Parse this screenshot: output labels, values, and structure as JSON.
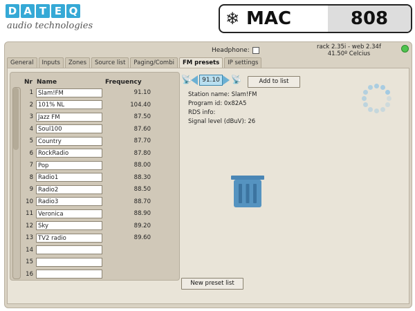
{
  "header": {
    "brand_letters": [
      "D",
      "A",
      "T",
      "E",
      "Q"
    ],
    "brand_subtitle": "audio technologies",
    "product_name": "MAC",
    "product_number": "808"
  },
  "topbar": {
    "headphone_label": "Headphone:",
    "headphone_checked": false,
    "rack_version": "rack 2.35i - web 2.34f",
    "temperature": "41.50º Celcius",
    "status_color": "#4fc34f"
  },
  "tabs": [
    {
      "label": "General",
      "active": false
    },
    {
      "label": "Inputs",
      "active": false
    },
    {
      "label": "Zones",
      "active": false
    },
    {
      "label": "Source list",
      "active": false
    },
    {
      "label": "Paging/Combi",
      "active": false
    },
    {
      "label": "FM presets",
      "active": true
    },
    {
      "label": "IP settings",
      "active": false
    }
  ],
  "presets": {
    "columns": {
      "nr": "Nr",
      "name": "Name",
      "frequency": "Frequency"
    },
    "rows": [
      {
        "nr": "1",
        "name": "Slam!FM",
        "freq": "91.10"
      },
      {
        "nr": "2",
        "name": "101% NL",
        "freq": "104.40"
      },
      {
        "nr": "3",
        "name": "Jazz FM",
        "freq": "87.50"
      },
      {
        "nr": "4",
        "name": "Soul100",
        "freq": "87.60"
      },
      {
        "nr": "5",
        "name": "Country",
        "freq": "87.70"
      },
      {
        "nr": "6",
        "name": "RockRadio",
        "freq": "87.80"
      },
      {
        "nr": "7",
        "name": "Pop",
        "freq": "88.00"
      },
      {
        "nr": "8",
        "name": "Radio1",
        "freq": "88.30"
      },
      {
        "nr": "9",
        "name": "Radio2",
        "freq": "88.50"
      },
      {
        "nr": "10",
        "name": "Radio3",
        "freq": "88.70"
      },
      {
        "nr": "11",
        "name": "Veronica",
        "freq": "88.90"
      },
      {
        "nr": "12",
        "name": "Sky",
        "freq": "89.20"
      },
      {
        "nr": "13",
        "name": "TV2 radio",
        "freq": "89.60"
      },
      {
        "nr": "14",
        "name": "",
        "freq": ""
      },
      {
        "nr": "15",
        "name": "",
        "freq": ""
      },
      {
        "nr": "16",
        "name": "",
        "freq": ""
      }
    ]
  },
  "tuner": {
    "frequency": "91.10",
    "add_label": "Add to list",
    "new_preset_label": "New preset list",
    "station_name": "Station name: Slam!FM",
    "program_id": "Program id: 0x82A5",
    "rds_info": "RDS info:",
    "signal_level": "Signal level (dBuV): 26"
  },
  "icons": {
    "trash": "trash-icon",
    "spinner": "loading-spinner-icon",
    "antenna": "antenna-icon"
  },
  "colors": {
    "accent": "#35a9d6",
    "panel": "#d9d2c3",
    "trash": "#4a86b5"
  }
}
